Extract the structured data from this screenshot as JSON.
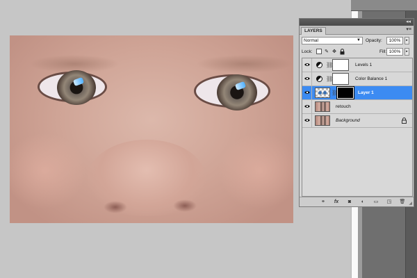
{
  "panel": {
    "tab_label": "LAYERS",
    "menu_glyph": "▾≡",
    "collapse_glyph": "◂◂",
    "blend_mode": "Normal",
    "opacity_label": "Opacity:",
    "opacity_value": "100%",
    "lock_label": "Lock:",
    "fill_label": "Fill:",
    "fill_value": "100%"
  },
  "layers": [
    {
      "name": "Levels 1",
      "type": "adjustment",
      "mask": "white",
      "visible": true,
      "selected": false
    },
    {
      "name": "Color Balance 1",
      "type": "adjustment",
      "mask": "white",
      "visible": true,
      "selected": false
    },
    {
      "name": "Layer 1",
      "type": "pixel-with-mask",
      "mask": "black",
      "visible": true,
      "selected": true
    },
    {
      "name": "retouch",
      "type": "pixel",
      "visible": true,
      "selected": false
    },
    {
      "name": "Background",
      "type": "background",
      "visible": true,
      "selected": false,
      "locked": true
    }
  ],
  "footer_icons": [
    "link-layers-icon",
    "fx-icon",
    "add-mask-icon",
    "new-adjustment-icon",
    "new-group-icon",
    "new-layer-icon",
    "trash-icon"
  ],
  "colors": {
    "selection": "#3c8bf2",
    "panel_bg": "#d6d6d6",
    "workspace": "#c6c6c6"
  }
}
